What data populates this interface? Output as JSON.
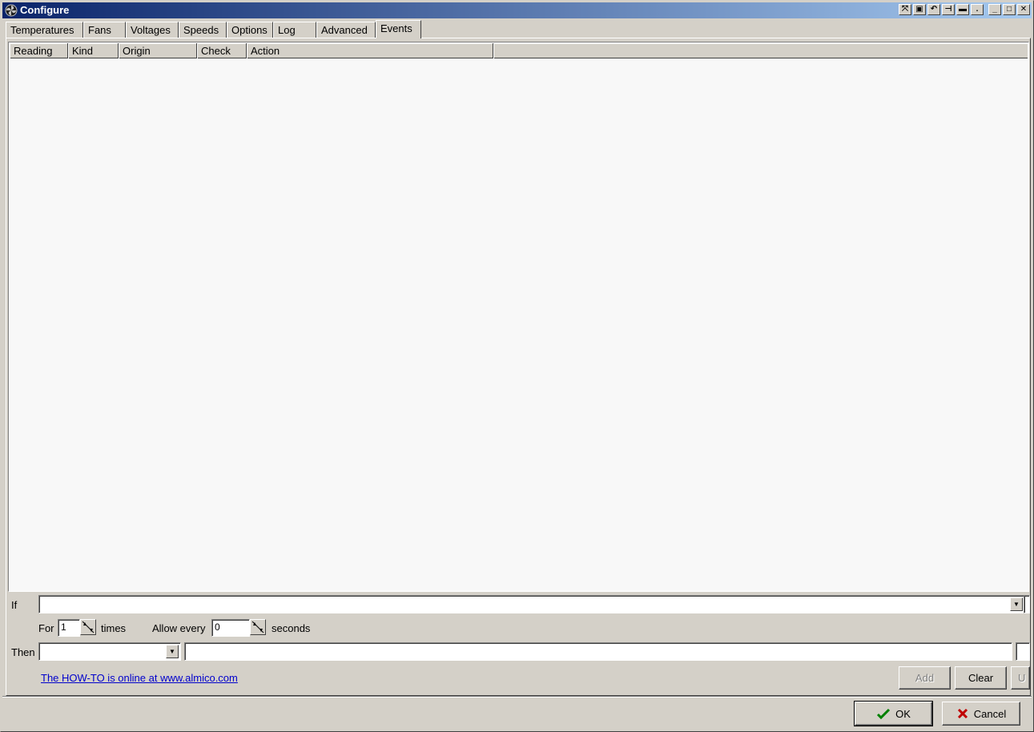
{
  "window": {
    "title": "Configure",
    "titlebar_buttons": [
      "resize-icon",
      "restore-alt-icon",
      "back-icon",
      "pin-icon",
      "minimize-bar-icon",
      "dot-icon",
      "minimize-icon",
      "maximize-icon",
      "close-icon"
    ]
  },
  "tabs": [
    {
      "label": "Temperatures",
      "active": false
    },
    {
      "label": "Fans",
      "active": false
    },
    {
      "label": "Voltages",
      "active": false
    },
    {
      "label": "Speeds",
      "active": false
    },
    {
      "label": "Options",
      "active": false
    },
    {
      "label": "Log",
      "active": false
    },
    {
      "label": "Advanced",
      "active": false
    },
    {
      "label": "Events",
      "active": true
    }
  ],
  "list": {
    "columns": [
      "Reading",
      "Kind",
      "Origin",
      "Check",
      "Action"
    ],
    "rows": []
  },
  "editor": {
    "if_label": "If",
    "if_value": "",
    "for_label": "For",
    "for_value": "1",
    "times_label": "times",
    "allow_label": "Allow every",
    "allow_value": "0",
    "seconds_label": "seconds",
    "then_label": "Then",
    "then_value": "",
    "then_param": "",
    "howto_link": "The HOW-TO is online at www.almico.com",
    "add_label": "Add",
    "clear_label": "Clear",
    "update_label": "U"
  },
  "footer": {
    "ok_label": "OK",
    "cancel_label": "Cancel"
  },
  "colors": {
    "face": "#d4d0c8",
    "title_start": "#0a246a",
    "title_end": "#a6caf0",
    "link": "#0000cc",
    "ok_check": "#008000",
    "cancel_x": "#c00000"
  }
}
